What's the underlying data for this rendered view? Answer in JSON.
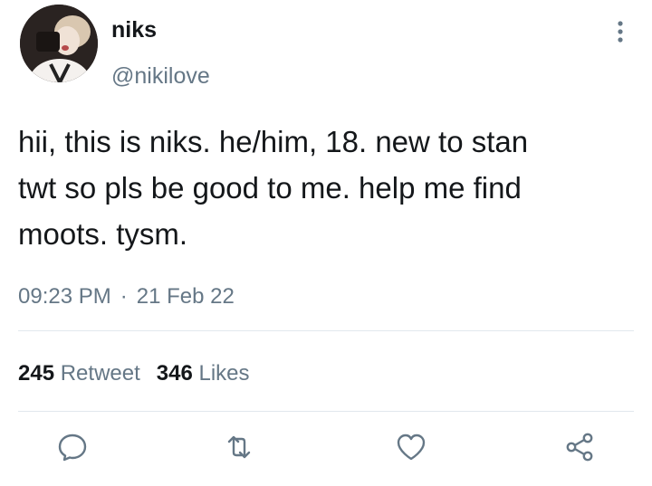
{
  "user": {
    "name": "niks",
    "handle": "@nikilove"
  },
  "tweet": {
    "text": "hii, this is niks. he/him, 18. new to stan\ntwt so pls be good to me. help me find\nmoots. tysm.",
    "time": "09:23 PM",
    "separator": "·",
    "date": "21 Feb 22"
  },
  "stats": {
    "retweets": "245",
    "retweet_label": "Retweet",
    "likes": "346",
    "likes_label": "Likes"
  },
  "icons": {
    "more": "more-vertical-icon",
    "reply": "reply-icon",
    "retweet": "retweet-icon",
    "like": "heart-icon",
    "share": "share-icon"
  },
  "colors": {
    "text": "#14171a",
    "secondary": "#657786",
    "divider": "#e1e8ed"
  }
}
